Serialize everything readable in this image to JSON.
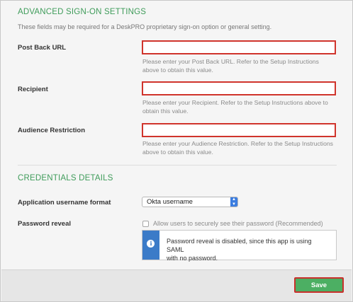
{
  "advanced": {
    "title": "ADVANCED SIGN-ON SETTINGS",
    "description": "These fields may be required for a DeskPRO proprietary sign-on option or general setting.",
    "fields": [
      {
        "label": "Post Back URL",
        "value": "",
        "help_line1": "Please enter your Post Back URL. Refer to the Setup Instructions",
        "help_line2": "above to obtain this value."
      },
      {
        "label": "Recipient",
        "value": "",
        "help_line1": "Please enter your Recipient. Refer to the Setup Instructions above to",
        "help_line2": "obtain this value."
      },
      {
        "label": "Audience Restriction",
        "value": "",
        "help_line1": "Please enter your Audience Restriction. Refer to the Setup Instructions",
        "help_line2": "above to obtain this value."
      }
    ]
  },
  "credentials": {
    "title": "CREDENTIALS DETAILS",
    "username_format_label": "Application username format",
    "username_format_value": "Okta username",
    "password_reveal_label": "Password reveal",
    "password_reveal_checkbox_label": "Allow users to securely see their password (Recommended)",
    "password_reveal_checked": false,
    "info_line1": "Password reveal is disabled, since this app is using SAML",
    "info_line2": "with no password."
  },
  "footer": {
    "save_label": "Save"
  },
  "colors": {
    "accent_green": "#3f9c5a",
    "highlight_red": "#d0342c",
    "info_blue": "#3b7bc8",
    "save_green": "#4caf63"
  },
  "icons": {
    "info": "info-icon",
    "select_arrows": "select-arrows-icon"
  }
}
